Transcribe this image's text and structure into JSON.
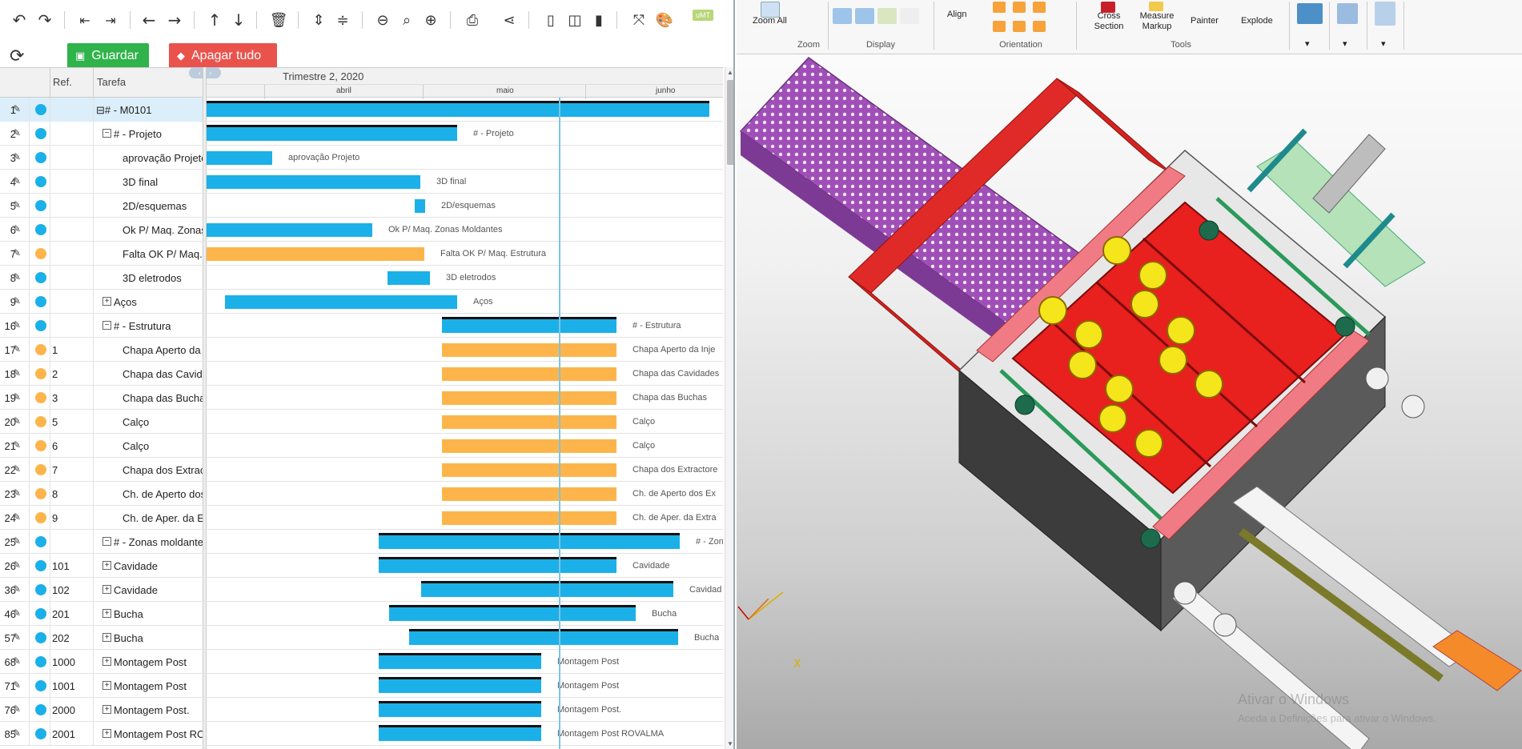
{
  "toolbar": {
    "icons": [
      "undo-icon",
      "redo-icon",
      "outdent-icon",
      "indent-icon",
      "move-left-icon",
      "move-right-icon",
      "move-up-icon",
      "move-down-icon",
      "delete-icon",
      "expand-all-icon",
      "collapse-all-icon",
      "zoom-out-icon",
      "zoom-fit-icon",
      "zoom-in-icon",
      "print-icon",
      "share-icon",
      "grid-only-icon",
      "split-view-icon",
      "chart-only-icon",
      "fullscreen-icon",
      "palette-icon"
    ],
    "badge": "uMT"
  },
  "actions": {
    "save_label": "Guardar",
    "clear_label": "Apagar tudo"
  },
  "grid": {
    "col_ref": "Ref.",
    "col_task": "Tarefa"
  },
  "timeline": {
    "quarter": "Trimestre 2, 2020",
    "months": [
      "abril",
      "maio",
      "junho"
    ],
    "nav": "‹ ● ›"
  },
  "colors": {
    "blue": "#1cb0e8",
    "orange": "#fdb54b",
    "save": "#2fb34a",
    "clear": "#e9534c"
  },
  "rows": [
    {
      "num": "1",
      "ref": "",
      "task": "⊟# - M0101",
      "indent": 0,
      "toggle": "−",
      "status": "blue",
      "summary": true,
      "label": "",
      "sel": true
    },
    {
      "num": "2",
      "ref": "",
      "task": "# - Projeto",
      "indent": 1,
      "toggle": "−",
      "status": "blue",
      "summary": true,
      "label": "# - Projeto"
    },
    {
      "num": "3",
      "ref": "",
      "task": "aprovação Projeto",
      "indent": 2,
      "status": "blue",
      "label": "aprovação Projeto"
    },
    {
      "num": "4",
      "ref": "",
      "task": "3D final",
      "indent": 2,
      "status": "blue",
      "label": "3D final"
    },
    {
      "num": "5",
      "ref": "",
      "task": "2D/esquemas",
      "indent": 2,
      "status": "blue",
      "label": "2D/esquemas"
    },
    {
      "num": "6",
      "ref": "",
      "task": "Ok P/ Maq. Zonas Moldantes",
      "indent": 2,
      "status": "blue",
      "label": "Ok P/ Maq. Zonas Moldantes"
    },
    {
      "num": "7",
      "ref": "",
      "task": "Falta OK P/ Maq. Estrutura",
      "indent": 2,
      "status": "orange",
      "label": "Falta OK P/ Maq. Estrutura"
    },
    {
      "num": "8",
      "ref": "",
      "task": "3D eletrodos",
      "indent": 2,
      "status": "blue",
      "label": "3D eletrodos"
    },
    {
      "num": "9",
      "ref": "",
      "task": "Aços",
      "indent": 1,
      "toggle": "+",
      "status": "blue",
      "label": "Aços"
    },
    {
      "num": "16",
      "ref": "",
      "task": "# - Estrutura",
      "indent": 1,
      "toggle": "−",
      "status": "blue",
      "summary": true,
      "label": "# - Estrutura"
    },
    {
      "num": "17",
      "ref": "1",
      "task": "Chapa Aperto da Injeção",
      "indent": 2,
      "status": "orange",
      "label": "Chapa Aperto da Inje"
    },
    {
      "num": "18",
      "ref": "2",
      "task": "Chapa das Cavidades",
      "indent": 2,
      "status": "orange",
      "label": "Chapa das Cavidades"
    },
    {
      "num": "19",
      "ref": "3",
      "task": "Chapa das Buchas",
      "indent": 2,
      "status": "orange",
      "label": "Chapa das Buchas"
    },
    {
      "num": "20",
      "ref": "5",
      "task": "Calço",
      "indent": 2,
      "status": "orange",
      "label": "Calço"
    },
    {
      "num": "21",
      "ref": "6",
      "task": "Calço",
      "indent": 2,
      "status": "orange",
      "label": "Calço"
    },
    {
      "num": "22",
      "ref": "7",
      "task": "Chapa dos Extractores",
      "indent": 2,
      "status": "orange",
      "label": "Chapa dos Extractore"
    },
    {
      "num": "23",
      "ref": "8",
      "task": "Ch. de Aperto dos Extractores",
      "indent": 2,
      "status": "orange",
      "label": "Ch. de Aperto dos Ex"
    },
    {
      "num": "24",
      "ref": "9",
      "task": "Ch. de Aper. da Extracção",
      "indent": 2,
      "status": "orange",
      "label": "Ch. de Aper. da Extra"
    },
    {
      "num": "25",
      "ref": "",
      "task": "# - Zonas moldantes",
      "indent": 1,
      "toggle": "−",
      "status": "blue",
      "summary": true,
      "label": "# - Zon"
    },
    {
      "num": "26",
      "ref": "101",
      "task": "Cavidade",
      "indent": 1,
      "toggle": "+",
      "status": "blue",
      "summary": true,
      "label": "Cavidade"
    },
    {
      "num": "36",
      "ref": "102",
      "task": "Cavidade",
      "indent": 1,
      "toggle": "+",
      "status": "blue",
      "summary": true,
      "label": "Cavidad"
    },
    {
      "num": "46",
      "ref": "201",
      "task": "Bucha",
      "indent": 1,
      "toggle": "+",
      "status": "blue",
      "summary": true,
      "label": "Bucha"
    },
    {
      "num": "57",
      "ref": "202",
      "task": "Bucha",
      "indent": 1,
      "toggle": "+",
      "status": "blue",
      "summary": true,
      "label": "Bucha"
    },
    {
      "num": "68",
      "ref": "1000",
      "task": "Montagem Post",
      "indent": 1,
      "toggle": "+",
      "status": "blue",
      "summary": true,
      "label": "Montagem Post"
    },
    {
      "num": "71",
      "ref": "1001",
      "task": "Montagem Post",
      "indent": 1,
      "toggle": "+",
      "status": "blue",
      "summary": true,
      "label": "Montagem Post"
    },
    {
      "num": "76",
      "ref": "2000",
      "task": "Montagem Post.",
      "indent": 1,
      "toggle": "+",
      "status": "blue",
      "summary": true,
      "label": "Montagem Post."
    },
    {
      "num": "85",
      "ref": "2001",
      "task": "Montagem Post ROVALMA",
      "indent": 1,
      "toggle": "+",
      "status": "blue",
      "summary": true,
      "label": "Montagem Post ROVALMA"
    }
  ],
  "cad": {
    "ribbon": {
      "zoom_all": "Zoom All",
      "align": "Align",
      "cross_section": "Cross Section",
      "measure_markup": "Measure Markup",
      "painter": "Painter",
      "explode": "Explode",
      "groups": [
        "Zoom",
        "Display",
        "Orientation",
        "Tools"
      ]
    },
    "axis_label": "X",
    "watermark_title": "Ativar o Windows",
    "watermark_sub": "Aceda a Definições para ativar o Windows."
  }
}
